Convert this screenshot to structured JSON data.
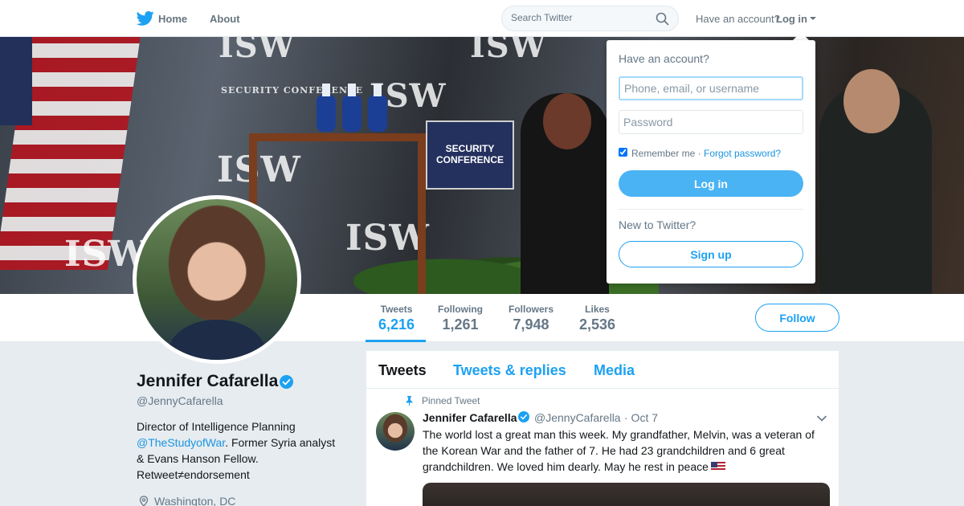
{
  "nav": {
    "home_label": "Home",
    "about_label": "About",
    "search_placeholder": "Search Twitter",
    "have_account": "Have an account?",
    "login_label": "Log in"
  },
  "banner": {
    "wall_text": "ISW",
    "sign_text": "SECURITY CONFERENCE"
  },
  "profile": {
    "name": "Jennifer Cafarella",
    "handle": "@JennyCafarella",
    "bio_line1": "Director of Intelligence Planning",
    "bio_link": "@TheStudyofWar",
    "bio_rest": ". Former Syria analyst & Evans Hanson Fellow. Retweet≠endorsement",
    "location": "Washington, DC",
    "verified": true
  },
  "stats": [
    {
      "label": "Tweets",
      "value": "6,216",
      "active": true
    },
    {
      "label": "Following",
      "value": "1,261",
      "active": false
    },
    {
      "label": "Followers",
      "value": "7,948",
      "active": false
    },
    {
      "label": "Likes",
      "value": "2,536",
      "active": false
    }
  ],
  "follow_label": "Follow",
  "timeline": {
    "tabs": [
      {
        "label": "Tweets",
        "active": true
      },
      {
        "label": "Tweets & replies",
        "active": false
      },
      {
        "label": "Media",
        "active": false
      }
    ],
    "pinned_label": "Pinned Tweet",
    "tweet": {
      "name": "Jennifer Cafarella",
      "handle": "@JennyCafarella",
      "date": "· Oct 7",
      "text": "The world lost a great man this week. My grandfather, Melvin, was a veteran of the Korean War and the father of 7. He had 23 grandchildren and 6 great grandchildren. We loved him dearly. May he rest in peace"
    }
  },
  "login_dropdown": {
    "heading": "Have an account?",
    "username_placeholder": "Phone, email, or username",
    "password_placeholder": "Password",
    "remember_label": "Remember me ·",
    "forgot_label": "Forgot password?",
    "login_button": "Log in",
    "new_label": "New to Twitter?",
    "signup_button": "Sign up",
    "remember_checked": true
  },
  "colors": {
    "accent": "#1da1f2",
    "link": "#1b95e0",
    "page_bg": "#e6ecf0",
    "login_button": "#4ab3f4"
  }
}
